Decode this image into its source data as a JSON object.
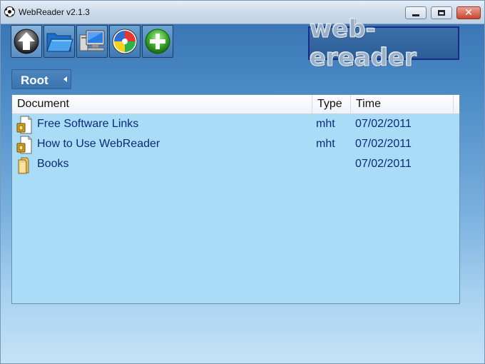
{
  "window": {
    "title": "WebReader v2.1.3",
    "close_glyph": "✕"
  },
  "toolbar": {
    "buttons": [
      {
        "icon": "up-arrow-icon",
        "label": "Up"
      },
      {
        "icon": "folder-icon",
        "label": "Open"
      },
      {
        "icon": "computer-icon",
        "label": "Computer"
      },
      {
        "icon": "color-wheel-icon",
        "label": "Colors"
      },
      {
        "icon": "add-icon",
        "label": "Add"
      }
    ]
  },
  "logo": {
    "text": "web-ereader"
  },
  "breadcrumb": {
    "label": "Root"
  },
  "list": {
    "columns": [
      "Document",
      "Type",
      "Time"
    ],
    "rows": [
      {
        "name": "Free Software Links",
        "type": "mht",
        "time": "07/02/2011",
        "icon": "document-icon"
      },
      {
        "name": "How to Use WebReader",
        "type": "mht",
        "time": "07/02/2011",
        "icon": "document-icon"
      },
      {
        "name": "Books",
        "type": "",
        "time": "07/02/2011",
        "icon": "folder-icon"
      }
    ]
  },
  "colors": {
    "list_background": "#a9dcf6",
    "link_text": "#0c2a7a",
    "accent": "#3a76b4"
  }
}
